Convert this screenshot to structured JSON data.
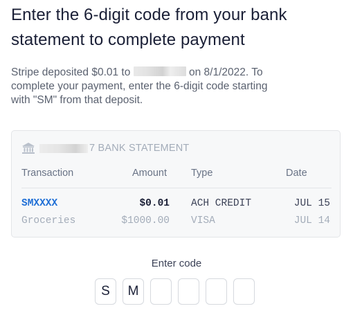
{
  "header": {
    "title_line1": "Enter the 6-digit code from your bank",
    "title_line2": "statement to complete payment"
  },
  "description": {
    "part1": "Stripe deposited $0.01 to",
    "part2": "on 8/1/2022. To",
    "line2": "complete your payment, enter the 6-digit code starting",
    "line3": "with \"SM\" from that deposit."
  },
  "statement": {
    "icon": "bank-icon",
    "heading_suffix": "7 BANK STATEMENT",
    "columns": [
      "Transaction",
      "Amount",
      "Type",
      "Date"
    ],
    "rows": [
      {
        "transaction": "SMXXXX",
        "amount": "$0.01",
        "type": "ACH CREDIT",
        "date": "JUL 15"
      },
      {
        "transaction": "Groceries",
        "amount": "$1000.00",
        "type": "VISA",
        "date": "JUL 14"
      }
    ]
  },
  "code": {
    "label": "Enter code",
    "digits": [
      "S",
      "M",
      "",
      "",
      "",
      ""
    ]
  },
  "colors": {
    "accent": "#1f6fd6",
    "muted": "#a3acb9",
    "text": "#1a1f36"
  }
}
